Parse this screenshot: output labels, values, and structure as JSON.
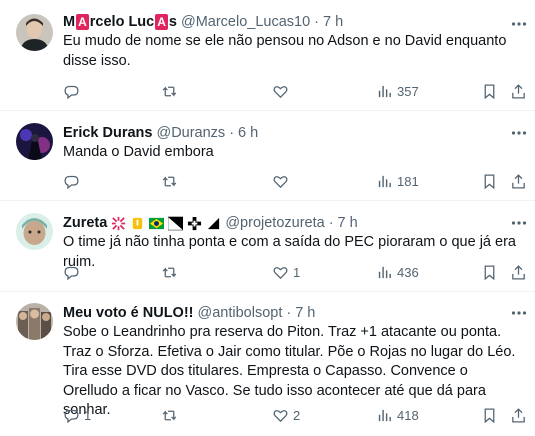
{
  "tweets": [
    {
      "name_prefix": "M",
      "name_badge1": "A",
      "name_mid": "rcelo Luc",
      "name_badge2": "A",
      "name_suffix": "s",
      "handle": "@Marcelo_Lucas10",
      "dot": "·",
      "time": "7 h",
      "text": "Eu mudo de nome se ele não pensou no Adson e no David enquanto disse isso.",
      "replies": "",
      "retweets": "",
      "likes": "",
      "views": "357"
    },
    {
      "name": "Erick Durans",
      "handle": "@Duranzs",
      "dot": "·",
      "time": "6 h",
      "text": "Manda o David embora",
      "replies": "",
      "retweets": "",
      "likes": "",
      "views": "181"
    },
    {
      "name": "Zureta",
      "handle": "@projetozureta",
      "dot": "·",
      "time": "7 h",
      "text": "O time já não tinha ponta e com a saída do PEC pioraram o que já era ruim.",
      "replies": "",
      "retweets": "",
      "likes": "1",
      "views": "436"
    },
    {
      "name": "Meu voto é NULO!!",
      "handle": "@antibolsopt",
      "dot": "·",
      "time": "7 h",
      "text": "Sobe o Leandrinho pra reserva do Piton. Traz +1 atacante ou ponta. Traz o Sforza. Efetiva o Jair como titular. Põe o Rojas no lugar do Léo. Tira esse DVD dos titulares. Empresta o Capasso. Convence o Orelludo a ficar no Vasco. Se tudo isso acontecer até que dá para sonhar.",
      "replies": "1",
      "retweets": "",
      "likes": "2",
      "views": "418"
    }
  ],
  "more_icon": "more-dots-icon",
  "colors": {
    "secondary": "#536471",
    "primary_text": "#0f1419",
    "divider": "#eff3f4",
    "badge": "#e0245e"
  }
}
